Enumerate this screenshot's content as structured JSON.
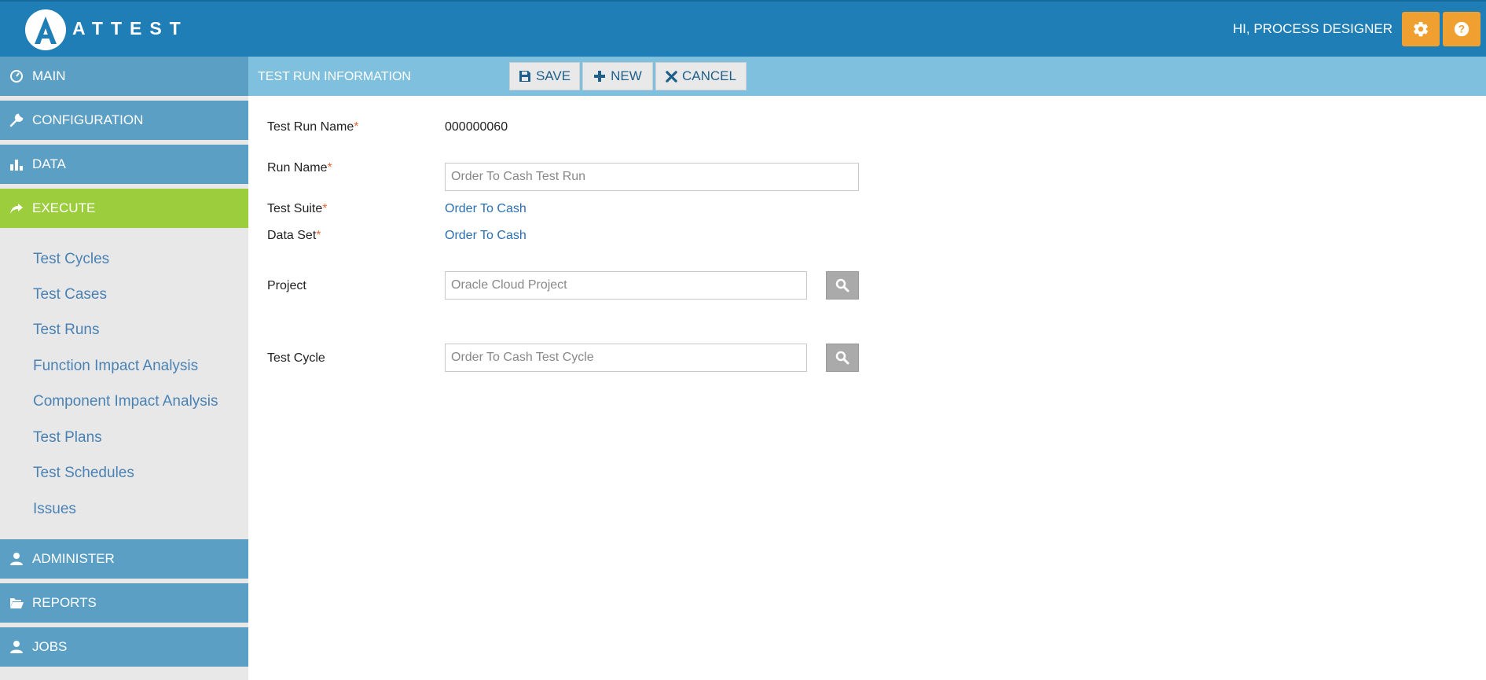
{
  "header": {
    "logo_text": "ATTEST",
    "greeting": "HI, PROCESS DESIGNER",
    "icons": {
      "settings": "gear-icon",
      "help": "help-icon"
    },
    "colors": {
      "bar": "#1f7eb5",
      "buttons": "#f0a030"
    }
  },
  "sidebar": {
    "main": "MAIN",
    "configuration": "CONFIGURATION",
    "data": "DATA",
    "execute": "EXECUTE",
    "execute_items": [
      "Test Cycles",
      "Test Cases",
      "Test Runs",
      "Function Impact Analysis",
      "Component Impact Analysis",
      "Test Plans",
      "Test Schedules",
      "Issues"
    ],
    "administer": "ADMINISTER",
    "reports": "REPORTS",
    "jobs": "JOBS",
    "colors": {
      "nav": "#5b9fc5",
      "active": "#9ccd3c",
      "sub_link": "#4a82b4"
    }
  },
  "toolbar": {
    "title": "TEST RUN INFORMATION",
    "save": "SAVE",
    "new": "NEW",
    "cancel": "CANCEL"
  },
  "form": {
    "test_run_name_label": "Test Run Name",
    "test_run_name_value": "000000060",
    "run_name_label": "Run Name",
    "run_name_placeholder": "Order To Cash Test Run",
    "test_suite_label": "Test Suite",
    "test_suite_value": "Order To Cash",
    "data_set_label": "Data Set",
    "data_set_value": "Order To Cash",
    "project_label": "Project",
    "project_placeholder": "Oracle Cloud Project",
    "test_cycle_label": "Test Cycle",
    "test_cycle_placeholder": "Order To Cash Test Cycle",
    "required_mark": "*"
  }
}
